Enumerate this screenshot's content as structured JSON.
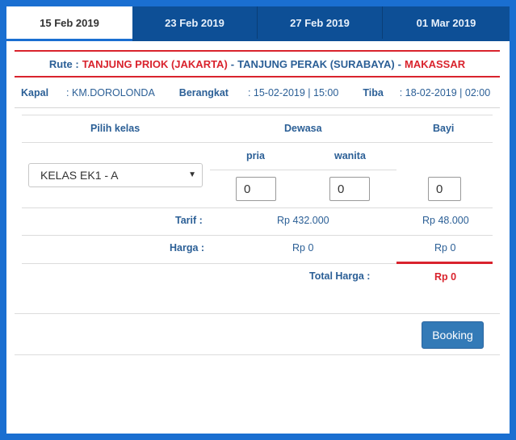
{
  "tabs": [
    {
      "label": "15 Feb 2019",
      "active": true
    },
    {
      "label": "23 Feb 2019",
      "active": false
    },
    {
      "label": "27 Feb 2019",
      "active": false
    },
    {
      "label": "01 Mar 2019",
      "active": false
    }
  ],
  "route": {
    "label": "Rute :",
    "origin": "TANJUNG PRIOK (JAKARTA)",
    "sep1": "-",
    "via": "TANJUNG PERAK (SURABAYA)",
    "sep2": "-",
    "destination": "MAKASSAR"
  },
  "ship": {
    "kapal_label": "Kapal",
    "kapal_value": ": KM.DOROLONDA",
    "berangkat_label": "Berangkat",
    "berangkat_value": ": 15-02-2019 | 15:00",
    "tiba_label": "Tiba",
    "tiba_value": ": 18-02-2019 | 02:00"
  },
  "booking": {
    "pilih_kelas_header": "Pilih kelas",
    "dewasa_header": "Dewasa",
    "bayi_header": "Bayi",
    "pria_header": "pria",
    "wanita_header": "wanita",
    "class_selected": "KELAS EK1 - A",
    "pria_qty": "0",
    "wanita_qty": "0",
    "bayi_qty": "0",
    "tarif_label": "Tarif :",
    "tarif_dewasa": "Rp 432.000",
    "tarif_bayi": "Rp 48.000",
    "harga_label": "Harga :",
    "harga_dewasa": "Rp 0",
    "harga_bayi": "Rp 0",
    "total_label": "Total Harga :",
    "total_value": "Rp 0",
    "button_label": "Booking"
  },
  "colors": {
    "background": "#1a6fd1",
    "tab_inactive": "#0d4f96",
    "route_red": "#d9232d",
    "text_blue": "#2b5f96",
    "button_blue": "#337ab7"
  }
}
